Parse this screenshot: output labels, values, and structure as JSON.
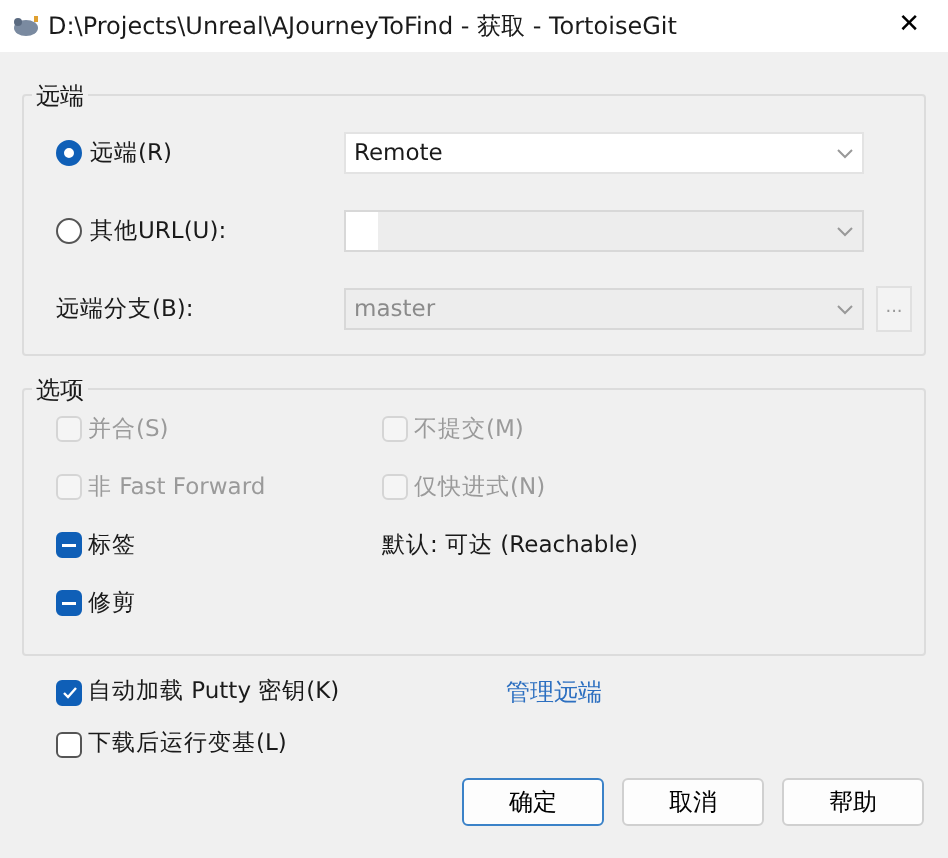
{
  "window": {
    "title": "D:\\Projects\\Unreal\\AJourneyToFind - 获取 - TortoiseGit",
    "close": "✕"
  },
  "remote_group": {
    "legend": "远端",
    "rows": [
      {
        "kind": "radio",
        "label": "远端(R)",
        "selected": true,
        "combo": {
          "value": "Remote",
          "disabled": false,
          "editable": false
        }
      },
      {
        "kind": "radio",
        "label": "其他URL(U):",
        "selected": false,
        "combo": {
          "disabled": true,
          "editable": true
        }
      },
      {
        "kind": "label",
        "label": "远端分支(B):",
        "combo": {
          "value": "master",
          "disabled": true,
          "editable": false
        },
        "browse": "..."
      }
    ]
  },
  "options_group": {
    "legend": "选项",
    "left": [
      {
        "label": "并合(S)",
        "checked": false,
        "disabled": true
      },
      {
        "label": "非 Fast Forward",
        "checked": false,
        "disabled": true
      },
      {
        "label": "标签",
        "partial": true,
        "disabled": false
      },
      {
        "label": "修剪",
        "partial": true,
        "disabled": false
      }
    ],
    "right": [
      {
        "kind": "checkbox",
        "label": "不提交(M)",
        "checked": false,
        "disabled": true
      },
      {
        "kind": "checkbox",
        "label": "仅快进式(N)",
        "checked": false,
        "disabled": true
      },
      {
        "kind": "text",
        "label": "默认: 可达 (Reachable)"
      }
    ]
  },
  "bottom": {
    "checks": [
      {
        "label": "自动加载 Putty 密钥(K)",
        "checked": true,
        "disabled": false
      },
      {
        "label": "下载后运行变基(L)",
        "checked": false,
        "disabled": false
      }
    ],
    "link": "管理远端"
  },
  "buttons": [
    {
      "label": "确定",
      "default": true
    },
    {
      "label": "取消",
      "default": false
    },
    {
      "label": "帮助",
      "default": false
    }
  ]
}
